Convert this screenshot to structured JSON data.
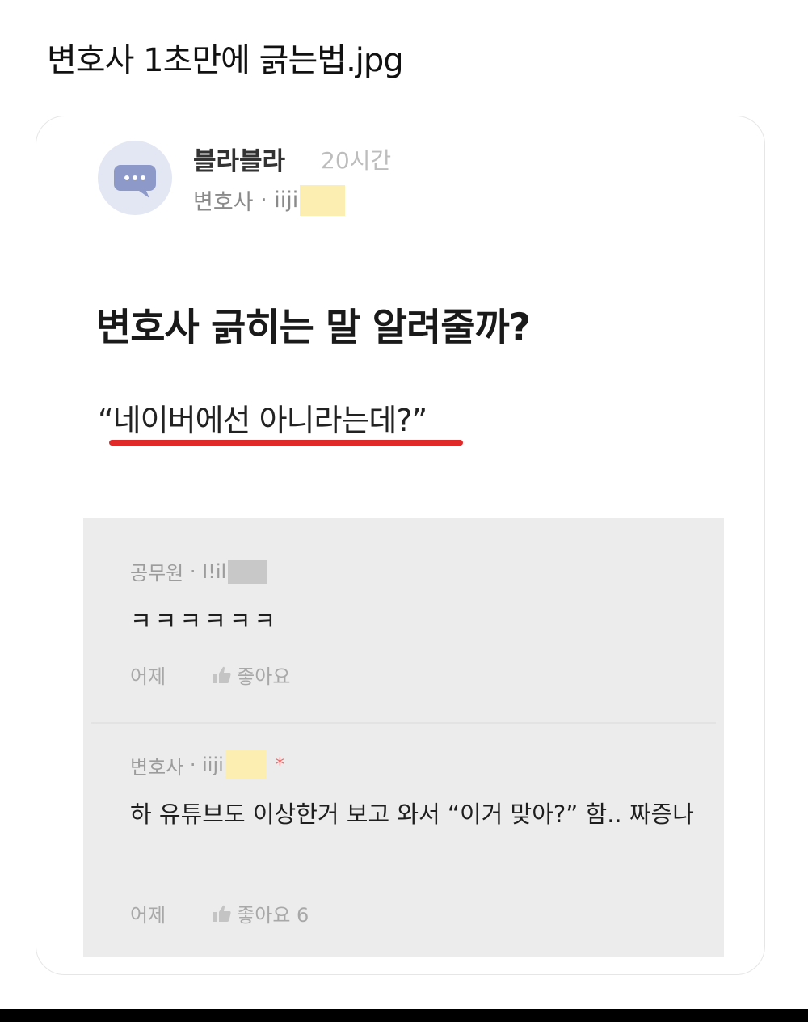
{
  "page_title": "변호사 1초만에 긁는법.jpg",
  "post": {
    "author": "블라블라",
    "time": "20시간",
    "meta_job": "변호사",
    "meta_sep": " · ",
    "meta_id": "iiji",
    "headline": "변호사 긁히는 말 알려줄까?",
    "quote": "“네이버에선 아니라는데?”"
  },
  "comments": [
    {
      "job": "공무원",
      "sep": " · ",
      "id": "I!il",
      "text": "ㅋㅋㅋㅋㅋㅋ",
      "time": "어제",
      "like_label": "좋아요"
    },
    {
      "job": "변호사",
      "sep": " · ",
      "id": "iiji",
      "author_mark": "*",
      "text": "하 유튜브도 이상한거 보고 와서 “이거 맞아?” 함.. 짜증나",
      "time": "어제",
      "like_label": "좋아요 6"
    }
  ],
  "icons": {
    "avatar": "chat-bubble-icon",
    "like": "thumbs-up-icon"
  },
  "colors": {
    "underline": "#e02a2a",
    "redact_yellow": "#fbeeb0",
    "redact_gray": "#c8c8c8",
    "comments_bg": "#ececec"
  }
}
